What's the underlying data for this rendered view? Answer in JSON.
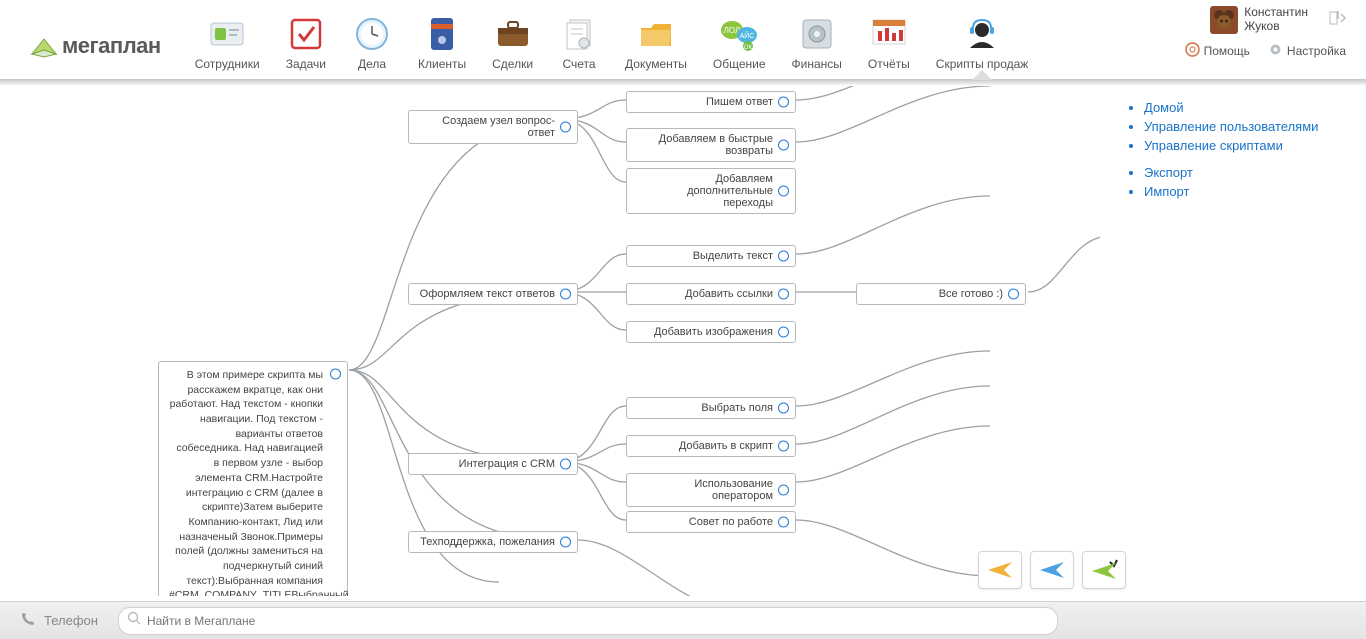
{
  "brand": "мегаплан",
  "nav": {
    "items": [
      {
        "label": "Сотрудники"
      },
      {
        "label": "Задачи"
      },
      {
        "label": "Дела"
      },
      {
        "label": "Клиенты"
      },
      {
        "label": "Сделки"
      },
      {
        "label": "Счета"
      },
      {
        "label": "Документы"
      },
      {
        "label": "Общение"
      },
      {
        "label": "Финансы"
      },
      {
        "label": "Отчёты"
      },
      {
        "label": "Скрипты продаж"
      }
    ]
  },
  "user": {
    "first": "Константин",
    "last": "Жуков"
  },
  "aux": {
    "help": "Помощь",
    "settings": "Настройка"
  },
  "sidebar": {
    "group1": [
      "Домой",
      "Управление пользователями",
      "Управление скриптами"
    ],
    "group2": [
      "Экспорт",
      "Импорт"
    ]
  },
  "nodes": {
    "root": "В этом примере скрипта мы расскажем вкратце, как они работают. Над текстом - кнопки навигации. Под текстом - варианты ответов собеседника. Над навигацией в первом узле - выбор элемента CRM.Настройте интеграцию с CRM (далее в скрипте)Затем выберите Компанию-контакт, Лид или назначеный Звонок.Примеры полей (должны замениться на подчеркнутый синий текст):Выбранная компания #CRM_COMPANY_TITLEВыбранный контакт #CRM_CONTACT_NAMEВыбранный",
    "b1": "Создаем узел вопрос-ответ",
    "b1a": "Пишем ответ",
    "b1b": "Добавляем в быстрые возвраты",
    "b1c": "Добавляем дополнительные переходы",
    "b2": "Оформляем текст ответов",
    "b2a": "Выделить текст",
    "b2b": "Добавить ссылки",
    "b2c": "Добавить изображения",
    "b2b_next": "Все готово :)",
    "b3": "Интеграция с CRM",
    "b3a": "Выбрать поля",
    "b3b": "Добавить в скрипт",
    "b3c": "Использование оператором",
    "b3d": "Совет по работе",
    "b4": "Техподдержка, пожелания"
  },
  "bottom": {
    "phone": "Телефон",
    "search_placeholder": "Найти в Мегаплане"
  }
}
